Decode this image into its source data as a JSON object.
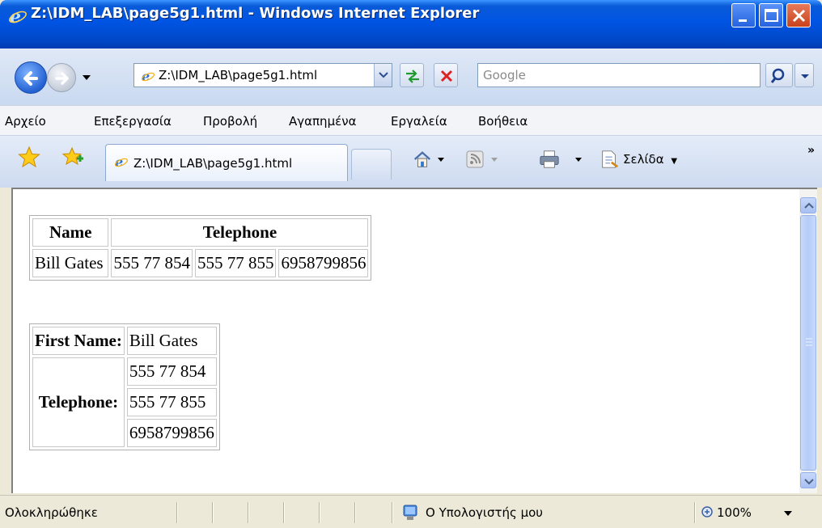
{
  "window": {
    "title": "Z:\\IDM_LAB\\page5g1.html - Windows Internet Explorer"
  },
  "addressbar": {
    "url": "Z:\\IDM_LAB\\page5g1.html",
    "search_placeholder": "Google"
  },
  "menu": {
    "items": [
      {
        "label": "Αρχείο"
      },
      {
        "label": "Επεξεργασία"
      },
      {
        "label": "Προβολή"
      },
      {
        "label": "Αγαπημένα"
      },
      {
        "label": "Εργαλεία"
      },
      {
        "label": "Βοήθεια"
      }
    ]
  },
  "tabs": {
    "active_label": "Z:\\IDM_LAB\\page5g1.html",
    "page_menu_label": "Σελίδα"
  },
  "content": {
    "table1": {
      "headers": [
        "Name",
        "Telephone"
      ],
      "row": [
        "Bill Gates",
        "555 77 854",
        "555 77 855",
        "6958799856"
      ]
    },
    "table2": {
      "first_name_label": "First Name:",
      "first_name_value": "Bill Gates",
      "telephone_label": "Telephone:",
      "phones": [
        "555 77 854",
        "555 77 855",
        "6958799856"
      ]
    }
  },
  "statusbar": {
    "status": "Ολοκληρώθηκε",
    "zone": "Ο Υπολογιστής μου",
    "zoom": "100%"
  },
  "colors": {
    "titlebar": "#0054e3",
    "toolbar": "#c9d9f0",
    "status_bg": "#ece9d8"
  }
}
